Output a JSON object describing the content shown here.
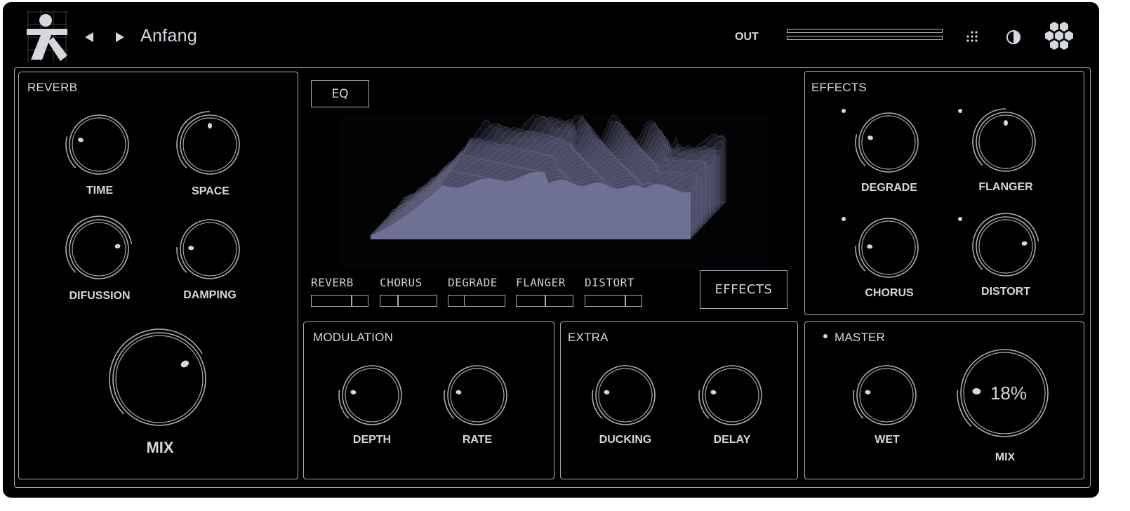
{
  "header": {
    "preset_name": "Anfang",
    "out_label": "OUT"
  },
  "reverb": {
    "title": "REVERB",
    "knobs": [
      {
        "label": "TIME",
        "value": 0.22
      },
      {
        "label": "SPACE",
        "value": 0.5
      },
      {
        "label": "DIFUSSION",
        "value": 0.8
      },
      {
        "label": "DAMPING",
        "value": 0.18
      }
    ],
    "mix": {
      "label": "MIX",
      "value": 0.72
    }
  },
  "eq": {
    "button_label": "EQ"
  },
  "fx_sends": [
    {
      "label": "REVERB",
      "value": 0.7
    },
    {
      "label": "CHORUS",
      "value": 0.3
    },
    {
      "label": "DEGRADE",
      "value": 0.27
    },
    {
      "label": "FLANGER",
      "value": 0.5
    },
    {
      "label": "DISTORT",
      "value": 0.7
    }
  ],
  "effects_button_label": "EFFECTS",
  "effects": {
    "title": "EFFECTS",
    "knobs": [
      {
        "label": "DEGRADE",
        "value": 0.22
      },
      {
        "label": "FLANGER",
        "value": 0.5
      },
      {
        "label": "CHORUS",
        "value": 0.18
      },
      {
        "label": "DISTORT",
        "value": 0.8
      }
    ]
  },
  "modulation": {
    "title": "MODULATION",
    "knobs": [
      {
        "label": "DEPTH",
        "value": 0.2
      },
      {
        "label": "RATE",
        "value": 0.2
      }
    ]
  },
  "extra": {
    "title": "EXTRA",
    "knobs": [
      {
        "label": "DUCKING",
        "value": 0.2
      },
      {
        "label": "DELAY",
        "value": 0.2
      }
    ]
  },
  "master": {
    "title": "MASTER",
    "wet": {
      "label": "WET",
      "value": 0.2
    },
    "mix": {
      "label": "MIX",
      "value": 0.18,
      "display": "18%"
    }
  },
  "colors": {
    "background": "#000000",
    "line": "#a8abb3",
    "text": "#d4d7de",
    "spectrum": "#6f7194"
  }
}
